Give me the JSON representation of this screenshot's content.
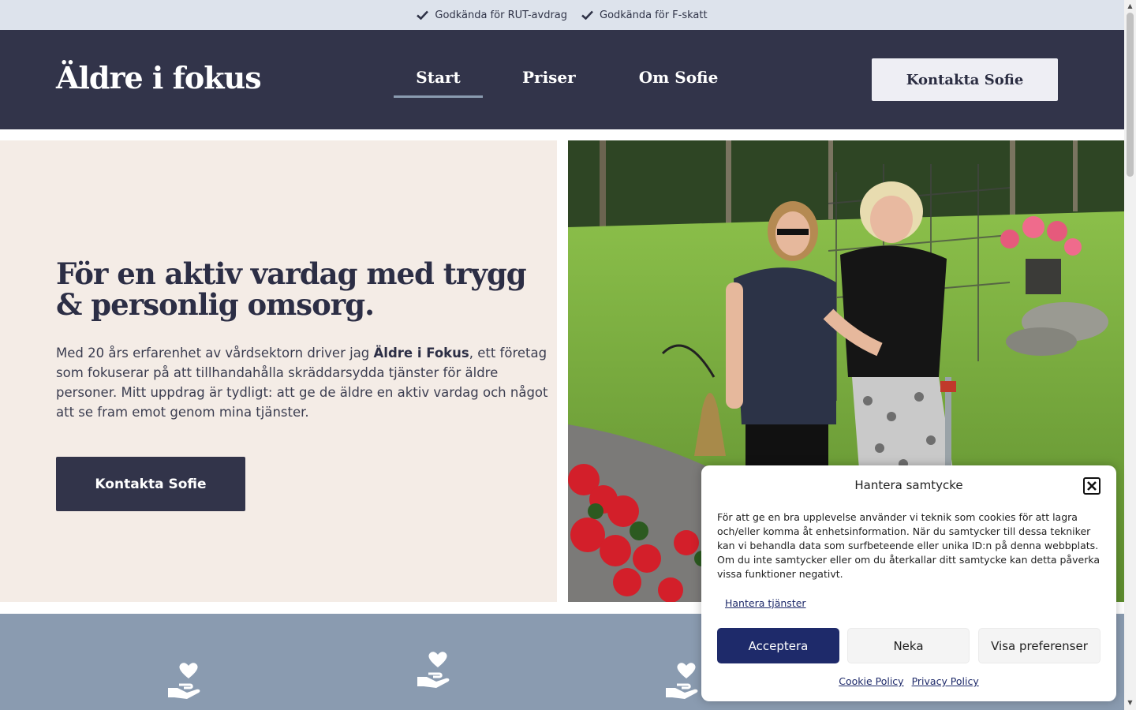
{
  "topbar": {
    "items": [
      {
        "label": "Godkända för RUT-avdrag",
        "icon": "check-icon"
      },
      {
        "label": "Godkända för F-skatt",
        "icon": "check-icon"
      }
    ]
  },
  "header": {
    "logo": "Äldre i fokus",
    "nav": [
      {
        "label": "Start",
        "active": true
      },
      {
        "label": "Priser",
        "active": false
      },
      {
        "label": "Om Sofie",
        "active": false
      }
    ],
    "cta": "Kontakta Sofie"
  },
  "hero": {
    "title": "För en aktiv vardag med trygg & personlig omsorg.",
    "text_before": "Med 20 års erfarenhet av vårdsektorn driver jag ",
    "text_bold": "Äldre i Fokus",
    "text_after": ", ett företag som fokuserar på att tillhandahålla skräddarsydda tjänster för äldre personer. Mitt uppdrag är tydligt: att ge de äldre en aktiv vardag och något att se fram emot genom mina tjänster.",
    "cta": "Kontakta Sofie",
    "photo": "photo-caregiver-walking-with-elderly-woman"
  },
  "services": {
    "icons": [
      "care-hand-heart-icon",
      "care-hand-heart-icon",
      "care-hand-heart-icon"
    ]
  },
  "consent": {
    "title": "Hantera samtycke",
    "text": "För att ge en bra upplevelse använder vi teknik som cookies för att lagra och/eller komma åt enhetsinformation. När du samtycker till dessa tekniker kan vi behandla data som surfbeteende eller unika ID:n på denna webbplats. Om du inte samtycker eller om du återkallar ditt samtycke kan detta påverka vissa funktioner negativt.",
    "manage_link": "Hantera tjänster",
    "accept": "Acceptera",
    "deny": "Neka",
    "preferences": "Visa preferenser",
    "cookie_policy": "Cookie Policy",
    "privacy_policy": "Privacy Policy"
  },
  "colors": {
    "topbar_bg": "#dde3ec",
    "header_bg": "#32344a",
    "hero_bg": "#f4ece6",
    "services_bg": "#8a9bb0",
    "accept_btn": "#1e2a6a"
  }
}
